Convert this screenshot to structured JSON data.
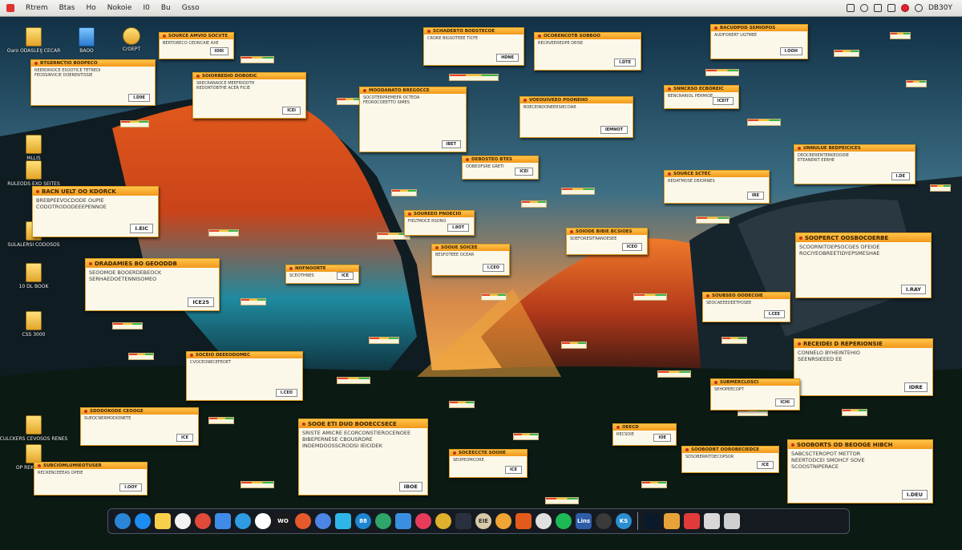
{
  "menubar": {
    "items": [
      "Rtrem",
      "Btas",
      "Ho",
      "Nokoie",
      "I0",
      "Bu",
      "Gsso"
    ],
    "right_text": "DB30Y"
  },
  "desktop_icons": [
    {
      "label": "Oaro ODASLEIJ CECAR"
    },
    {
      "label": "BAOO"
    },
    {
      "label": "CrOEPT"
    },
    {
      "label": "MLLIS"
    },
    {
      "label": "RULEODS EXO SEITES"
    },
    {
      "label": "SULALERSI CODOSOS"
    },
    {
      "label": "10 DL BOOK"
    },
    {
      "label": "CSS 3000"
    },
    {
      "label": "CULCKERS CEVOSOS RENES"
    },
    {
      "label": "OP REKAUMOS"
    }
  ],
  "alerts": [
    {
      "title": "BTGERNCTIO BOOPECO",
      "lines": [
        "REERDRIOCE ESOOTICE TETREDI",
        "FEOSSIRVICIE DOERENTISSIE"
      ],
      "button": "I.D9E"
    },
    {
      "title": "SOIORBEDIO DOBOEIC",
      "lines": [
        "SRECRANAOCE MEEFRIOOTH",
        "REDORTOBTHE ACER FICIE"
      ],
      "button": "ICEI"
    },
    {
      "title": "SOURCE AMVIO SOCVTE",
      "lines": [
        "BERTORECO CEDNCAIE AXE"
      ],
      "button": "IO0I"
    },
    {
      "title": "SCHADEBTO BODSTECOE",
      "lines": [
        "CRORE BIGSOTEEE TICFE"
      ],
      "button": "HDNE"
    },
    {
      "title": "OCORENCOTB SOBBOO",
      "lines": [
        "RECRVEEREDPE DEISE"
      ],
      "button": "I.DTE"
    },
    {
      "title": "BACUDPOD SSMIOPOS",
      "lines": [
        "AUDFORERT UGTMEE"
      ],
      "button": "I.OOH"
    },
    {
      "title": "MOODANATO BREGOCCE",
      "lines": [
        "SOCOTERPREMEER OCTEDA",
        "FEORDCOEETTO SIMES"
      ],
      "button": "IBET"
    },
    {
      "title": "VOEOUIVEEO POONEHO",
      "lines": [
        "BOECEINDONEERSIECOAR"
      ],
      "button": "IEMNOT"
    },
    {
      "title": "SNNCRSO ECBOREIC",
      "lines": [
        "BENCRARIOL PERMIOE"
      ],
      "button": "ICEIT"
    },
    {
      "title": "UNNULUE BEDPEICICES",
      "lines": [
        "DEOCRERENTERKEOODIE",
        "ETEANERIT EERHE"
      ],
      "button": "I.DE"
    },
    {
      "title": "BACN UELT OO KDORCK",
      "lines": [
        "BREBPEEVOCDODE OUPIE",
        "CODOTRODODEEEPENNOE"
      ],
      "button": "I.EIC"
    },
    {
      "title": "DEBOSTEO BTES",
      "lines": [
        "OOBEOFSRE GRETI"
      ],
      "button": "ICEI"
    },
    {
      "title": "SOURCE SCTEC",
      "lines": [
        "REDATMOSE DEIORNES"
      ],
      "button": "IRE"
    },
    {
      "title": "SOOPERCT OOSBOCOERBE",
      "lines": [
        "SCOORNITOEPSOCGES OFEIOE",
        "ROCIYEOBREETIDYEPSMESHAE"
      ],
      "button": "I.RAY"
    },
    {
      "title": "DRADAMIES BO GEOODDB",
      "lines": [
        "SEOOMOE BOOERDEBEOCK",
        "SERHAEDOETENNISOMEO"
      ],
      "button": "ICE25"
    },
    {
      "title": "NOFNOORTE",
      "lines": [
        "SCEOTHNES"
      ],
      "button": "ICE"
    },
    {
      "title": "SOUREEO PNOECIO",
      "lines": [
        "FIELTMOCE RSONO"
      ],
      "button": "I.8OT"
    },
    {
      "title": "SOOUE SOICEE",
      "lines": [
        "BESFOTEEE OCEAR"
      ],
      "button": "I.CEO"
    },
    {
      "title": "SOIODE BIBIE BCSIOES",
      "lines": [
        "SDEFORESITRANOESEE"
      ],
      "button": "ICEO"
    },
    {
      "title": "RECEIDEI D REPERIONSIE",
      "lines": [
        "CONNELO BYHEINTEHIO",
        "SEENRSIEEED EE"
      ],
      "button": "IDRE"
    },
    {
      "title": "SOUBSEO OODECOIE",
      "lines": [
        "SEOCAEEEDEETPOSEE"
      ],
      "button": "I.CEE"
    },
    {
      "title": "SUBMERCLOSCI",
      "lines": [
        "SEHOPEECOPT"
      ],
      "button": "ICHI"
    },
    {
      "title": "SOCEIO DEEEODOMEC",
      "lines": [
        "CVOCEONECEFEOET"
      ],
      "button": "I.CEO"
    },
    {
      "title": "SDODOKODE CEOOGE",
      "lines": [
        "SUEOCNERMODIONETE"
      ],
      "button": "ICE"
    },
    {
      "title": "SUBCIOMLUMIEOTUSER",
      "lines": [
        "RECRENCEEEAS OPEIE"
      ],
      "button": "I.OOY"
    },
    {
      "title": "SOOE ETI DUO BOOECCSECE",
      "lines": [
        "SRISTE AMICRE ECORCONSTIEROCENOEE",
        "BIBEPERNESE CBOUSRDRE",
        "INDEMDOOSSCRODSI IEICIDEK"
      ],
      "button": "IBOE"
    },
    {
      "title": "SOCEECCTE SOOIIE",
      "lines": [
        "SEOPEOMCORE"
      ],
      "button": "ICE"
    },
    {
      "title": "OEECD",
      "lines": [
        "RECSOIE"
      ],
      "button": "IOE"
    },
    {
      "title": "SOOBODBT OOROBECIEDCE",
      "lines": [
        "SDSOBERRITDECOPSOR"
      ],
      "button": "ICE"
    },
    {
      "title": "SOOBORTS OD BEOOGE HIBCH",
      "lines": [
        "SABCSCTEROPOT METTOR",
        "NEERTODCEI SMOHCF SOVE",
        "SCOOSTNIPERACE"
      ],
      "button": "I.DEU"
    }
  ],
  "dock": {
    "apps": [
      {
        "icon": "pause-app-icon",
        "color": "#2a86d6",
        "text": ""
      },
      {
        "icon": "safari-icon",
        "color": "#1d8cf0",
        "text": ""
      },
      {
        "icon": "notes-icon",
        "color": "#f7cf4a",
        "text": ""
      },
      {
        "icon": "notepad-icon",
        "color": "#f2f2f2",
        "text": ""
      },
      {
        "icon": "chrome-icon",
        "color": "#e04a3a",
        "text": ""
      },
      {
        "icon": "folder-icon",
        "color": "#3f8be8",
        "text": ""
      },
      {
        "icon": "photos-icon",
        "color": "#2f9be3",
        "text": ""
      },
      {
        "icon": "terminal-icon",
        "color": "#ffffff",
        "text": ""
      },
      {
        "icon": "calendar-icon",
        "color": "#1b1b1b",
        "text": "WO"
      },
      {
        "icon": "maps-icon",
        "color": "#e55a2a",
        "text": ""
      },
      {
        "icon": "app-store-icon",
        "color": "#4b86e6",
        "text": ""
      },
      {
        "icon": "messages-icon",
        "color": "#2fb6e8",
        "text": ""
      },
      {
        "icon": "mail-icon",
        "color": "#1d86d0",
        "text": "88"
      },
      {
        "icon": "chrome-alt-icon",
        "color": "#2fa56a",
        "text": ""
      },
      {
        "icon": "todo-icon",
        "color": "#3a8fe0",
        "text": ""
      },
      {
        "icon": "xmind-icon",
        "color": "#e83b5a",
        "text": ""
      },
      {
        "icon": "drive-icon",
        "color": "#e0b12c",
        "text": ""
      },
      {
        "icon": "stocks-icon",
        "color": "#2a3040",
        "text": ""
      },
      {
        "icon": "docs-icon",
        "color": "#d8c9a8",
        "text": "EIE"
      },
      {
        "icon": "photos-pinwheel-icon",
        "color": "#f0a434",
        "text": ""
      },
      {
        "icon": "info-icon",
        "color": "#e25a1c",
        "text": ""
      },
      {
        "icon": "textedit-icon",
        "color": "#e0e0e0",
        "text": ""
      },
      {
        "icon": "spotify-icon",
        "color": "#1db954",
        "text": ""
      },
      {
        "icon": "linear-icon",
        "color": "#2e5da8",
        "text": "Lins"
      },
      {
        "icon": "dots-app-icon",
        "color": "#3a3a3a",
        "text": ""
      },
      {
        "icon": "ks-app-icon",
        "color": "#2a8fd0",
        "text": "KS"
      }
    ],
    "system": [
      {
        "icon": "minimized-window-icon",
        "color": "#0b1a2a",
        "text": ""
      },
      {
        "icon": "stack-icon",
        "color": "#e8a23a",
        "text": ""
      },
      {
        "icon": "flipboard-icon",
        "color": "#e03a3a",
        "text": ""
      },
      {
        "icon": "downloads-icon",
        "color": "#d8d8d8",
        "text": ""
      },
      {
        "icon": "trash-icon",
        "color": "#cfcfcf",
        "text": ""
      }
    ]
  }
}
